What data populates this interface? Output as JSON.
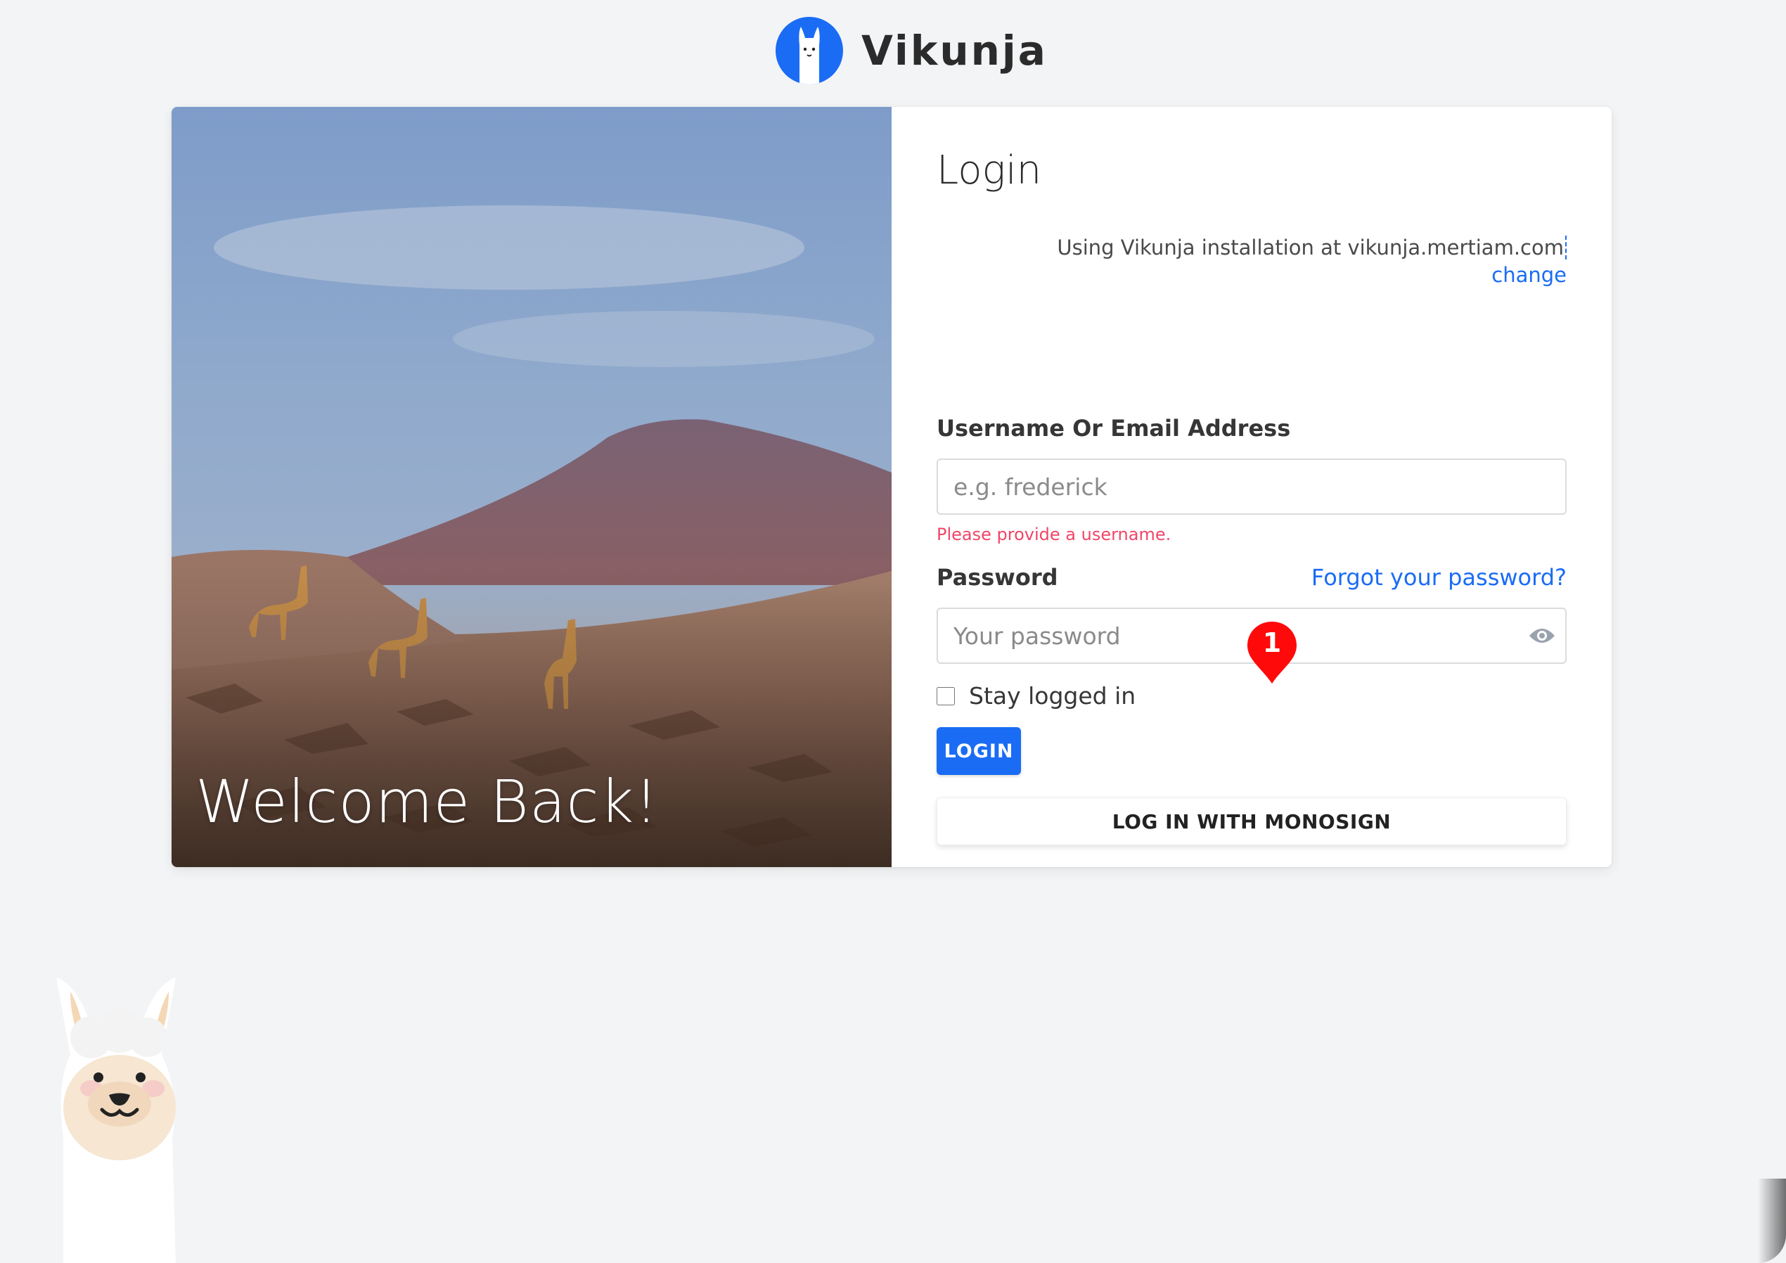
{
  "app": {
    "name": "Vikunja",
    "brand_color": "#1a6cf5"
  },
  "hero": {
    "welcome_text": "Welcome Back!"
  },
  "login": {
    "title": "Login",
    "api_notice": "Using Vikunja installation at vikunja.mertiam.com",
    "change_link": "change",
    "username": {
      "label": "Username Or Email Address",
      "placeholder": "e.g. frederick",
      "value": "",
      "error": "Please provide a username."
    },
    "password": {
      "label": "Password",
      "placeholder": "Your password",
      "value": "",
      "forgot_link": "Forgot your password?",
      "toggle_icon": "eye-icon"
    },
    "stay_logged_in": {
      "label": "Stay logged in",
      "checked": false
    },
    "login_button": "LOGIN",
    "oidc_button": "LOG IN WITH MONOSIGN"
  },
  "annotation": {
    "marker_number": "1",
    "marker_color": "#ff0000"
  }
}
